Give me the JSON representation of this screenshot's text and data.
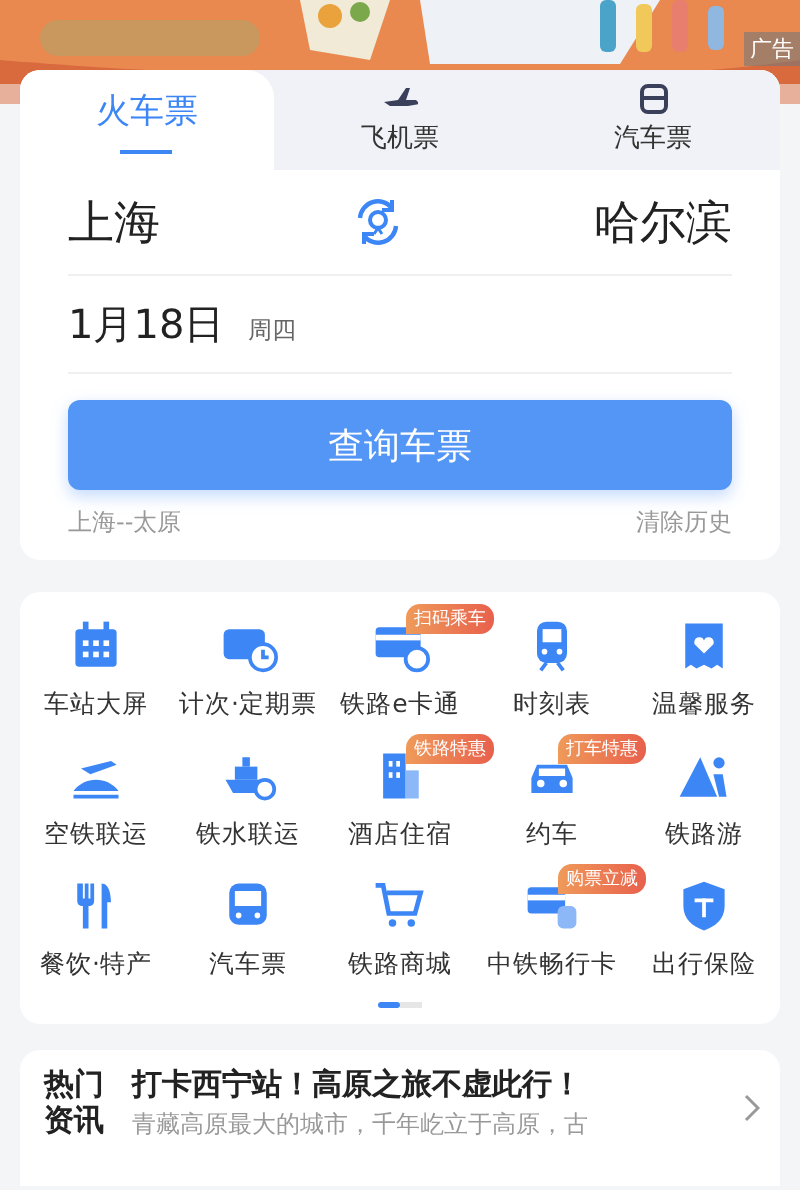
{
  "banner": {
    "ad_label": "广告"
  },
  "tabs": [
    {
      "label": "火车票",
      "selected": true
    },
    {
      "label": "飞机票",
      "selected": false
    },
    {
      "label": "汽车票",
      "selected": false
    }
  ],
  "route": {
    "from": "上海",
    "to": "哈尔滨"
  },
  "date": {
    "value": "1月18日",
    "weekday": "周四"
  },
  "search_button": "查询车票",
  "history": {
    "recent": "上海--太原",
    "clear": "清除历史"
  },
  "services": [
    {
      "label": "车站大屏"
    },
    {
      "label": "计次·定期票"
    },
    {
      "label": "铁路e卡通",
      "badge": "扫码乘车"
    },
    {
      "label": "时刻表"
    },
    {
      "label": "温馨服务"
    },
    {
      "label": "空铁联运"
    },
    {
      "label": "铁水联运"
    },
    {
      "label": "酒店住宿",
      "badge": "铁路特惠"
    },
    {
      "label": "约车",
      "badge": "打车特惠"
    },
    {
      "label": "铁路游"
    },
    {
      "label": "餐饮·特产"
    },
    {
      "label": "汽车票"
    },
    {
      "label": "铁路商城"
    },
    {
      "label": "中铁畅行卡",
      "badge": "购票立减"
    },
    {
      "label": "出行保险"
    }
  ],
  "pager": [
    {
      "selected": true
    },
    {
      "selected": false
    }
  ],
  "news": {
    "section": [
      "热门",
      "资讯"
    ],
    "title": "打卡西宁站！高原之旅不虚此行！",
    "summary": "青藏高原最大的城市，千年屹立于高原，古"
  }
}
